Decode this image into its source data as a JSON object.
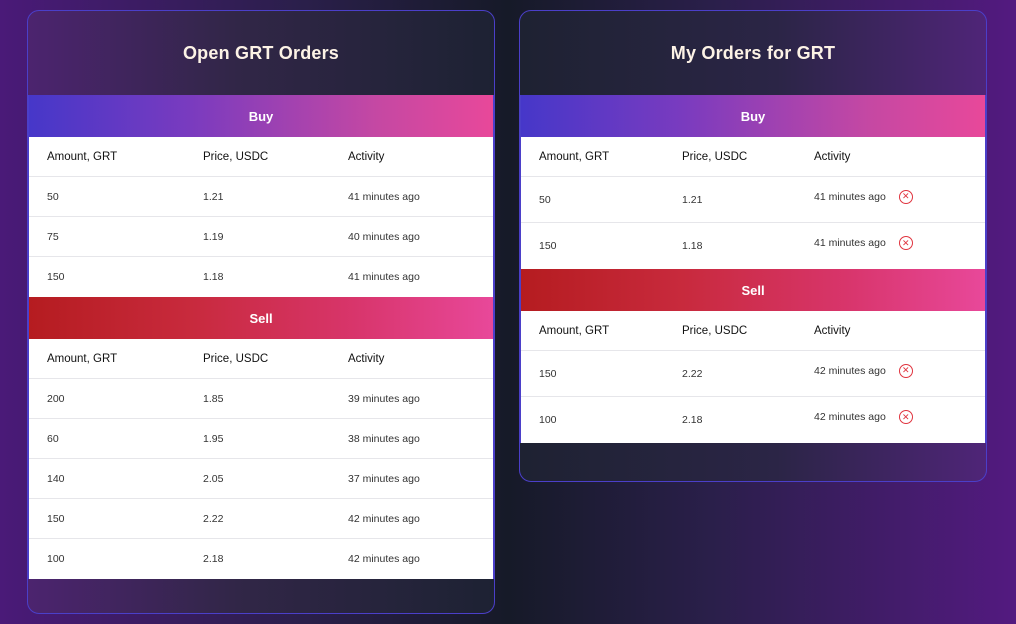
{
  "open_orders": {
    "title": "Open GRT Orders",
    "buy": {
      "label": "Buy",
      "columns": [
        "Amount, GRT",
        "Price, USDC",
        "Activity"
      ],
      "rows": [
        {
          "amount": "50",
          "price": "1.21",
          "activity": "41 minutes ago"
        },
        {
          "amount": "75",
          "price": "1.19",
          "activity": "40 minutes ago"
        },
        {
          "amount": "150",
          "price": "1.18",
          "activity": "41 minutes ago"
        }
      ]
    },
    "sell": {
      "label": "Sell",
      "columns": [
        "Amount, GRT",
        "Price, USDC",
        "Activity"
      ],
      "rows": [
        {
          "amount": "200",
          "price": "1.85",
          "activity": "39 minutes ago"
        },
        {
          "amount": "60",
          "price": "1.95",
          "activity": "38 minutes ago"
        },
        {
          "amount": "140",
          "price": "2.05",
          "activity": "37 minutes ago"
        },
        {
          "amount": "150",
          "price": "2.22",
          "activity": "42 minutes ago"
        },
        {
          "amount": "100",
          "price": "2.18",
          "activity": "42 minutes ago"
        }
      ]
    }
  },
  "my_orders": {
    "title": "My Orders for GRT",
    "buy": {
      "label": "Buy",
      "columns": [
        "Amount, GRT",
        "Price, USDC",
        "Activity"
      ],
      "rows": [
        {
          "amount": "50",
          "price": "1.21",
          "activity": "41 minutes ago"
        },
        {
          "amount": "150",
          "price": "1.18",
          "activity": "41 minutes ago"
        }
      ]
    },
    "sell": {
      "label": "Sell",
      "columns": [
        "Amount, GRT",
        "Price, USDC",
        "Activity"
      ],
      "rows": [
        {
          "amount": "150",
          "price": "2.22",
          "activity": "42 minutes ago"
        },
        {
          "amount": "100",
          "price": "2.18",
          "activity": "42 minutes ago"
        }
      ]
    },
    "cancel_icon": "close-circle-icon",
    "cancel_icon_color": "#e0343f"
  },
  "colors": {
    "panel_border": "#4b3fc9",
    "buy_gradient": [
      "#4637c9",
      "#e8489a"
    ],
    "sell_gradient": [
      "#b51c20",
      "#e8489a"
    ]
  }
}
